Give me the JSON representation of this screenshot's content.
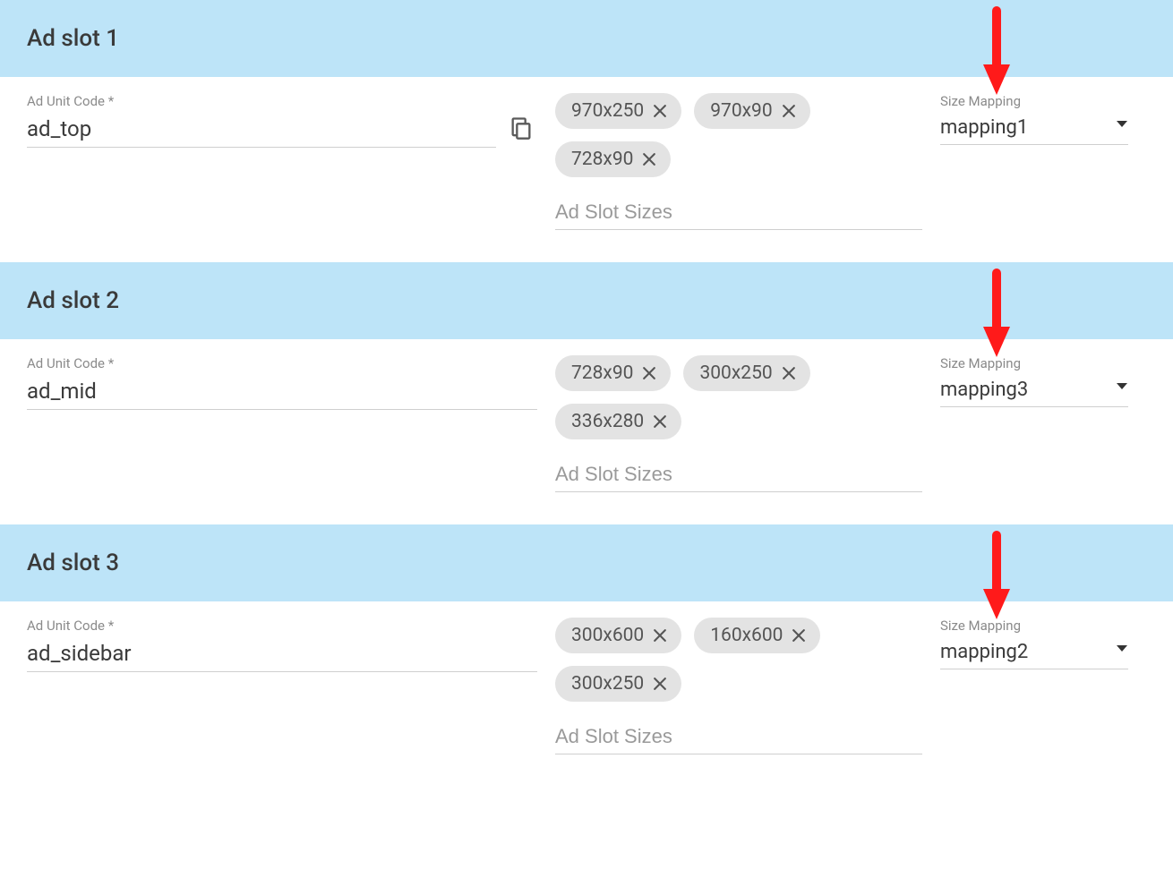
{
  "labels": {
    "ad_unit_code": "Ad Unit Code *",
    "size_mapping": "Size Mapping",
    "ad_slot_sizes_placeholder": "Ad Slot Sizes"
  },
  "slots": [
    {
      "title": "Ad slot 1",
      "code": "ad_top",
      "show_copy": true,
      "sizes": [
        "970x250",
        "970x90",
        "728x90"
      ],
      "mapping": "mapping1"
    },
    {
      "title": "Ad slot 2",
      "code": "ad_mid",
      "show_copy": false,
      "sizes": [
        "728x90",
        "300x250",
        "336x280"
      ],
      "mapping": "mapping3"
    },
    {
      "title": "Ad slot 3",
      "code": "ad_sidebar",
      "show_copy": false,
      "sizes": [
        "300x600",
        "160x600",
        "300x250"
      ],
      "mapping": "mapping2"
    }
  ]
}
